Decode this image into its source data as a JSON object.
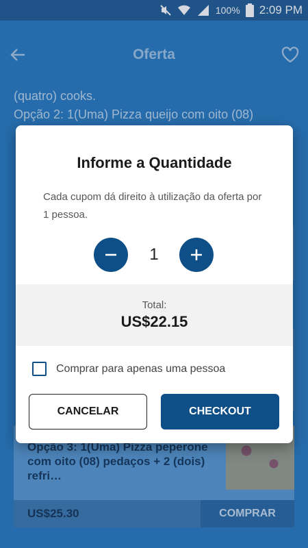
{
  "status_bar": {
    "battery": "100%",
    "time": "2:09 PM"
  },
  "app_bar": {
    "title": "Oferta"
  },
  "background": {
    "line1": "(quatro) cooks.",
    "line2": "Opção 2: 1(Uma) Pizza queijo com oito (08)",
    "card": {
      "title": "Opção 3: 1(Uma) Pizza peperone com oito (08) pedaços + 2 (dois) refri…",
      "price": "US$25.30",
      "buy_label": "COMPRAR"
    }
  },
  "dialog": {
    "title": "Informe a Quantidade",
    "description": "Cada cupom dá direito à utilização da oferta por 1 pessoa.",
    "quantity": "1",
    "total_label": "Total:",
    "total_value": "US$22.15",
    "single_person_label": "Comprar para apenas uma pessoa",
    "cancel_label": "CANCELAR",
    "checkout_label": "CHECKOUT"
  },
  "colors": {
    "primary": "#2a7cc2",
    "accent_dark": "#0e4f87"
  }
}
